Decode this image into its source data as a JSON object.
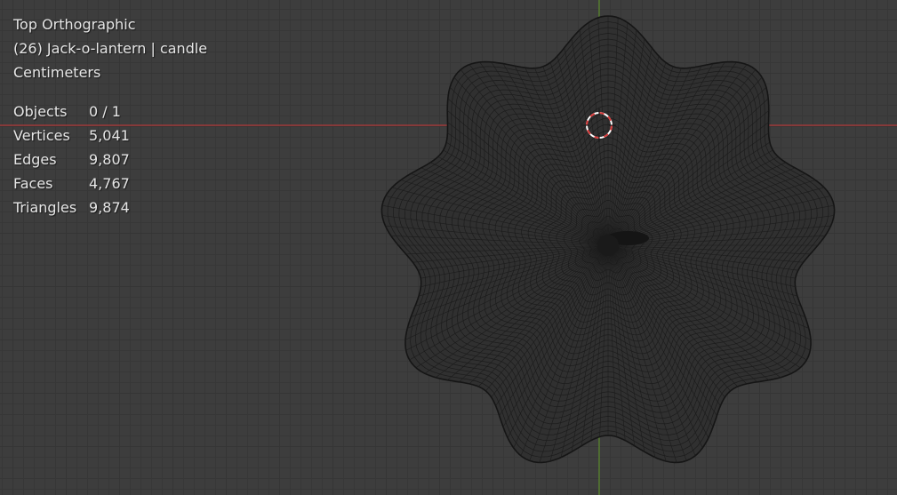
{
  "viewport": {
    "view_name": "Top Orthographic",
    "frame_object": "(26) Jack-o-lantern | candle",
    "units": "Centimeters"
  },
  "stats": [
    {
      "label": "Objects",
      "value": "0 / 1"
    },
    {
      "label": "Vertices",
      "value": "5,041"
    },
    {
      "label": "Edges",
      "value": "9,807"
    },
    {
      "label": "Faces",
      "value": "4,767"
    },
    {
      "label": "Triangles",
      "value": "9,874"
    }
  ],
  "colors": {
    "background": "#3d3d3d",
    "x_axis": "#b23a3a",
    "y_axis": "#5f8f2f",
    "mesh_fill": "#303030",
    "mesh_wire": "#1c1c1c",
    "cursor_red": "#d93a3a",
    "cursor_white": "#ffffff"
  },
  "icons": [
    "3d-cursor-icon"
  ]
}
